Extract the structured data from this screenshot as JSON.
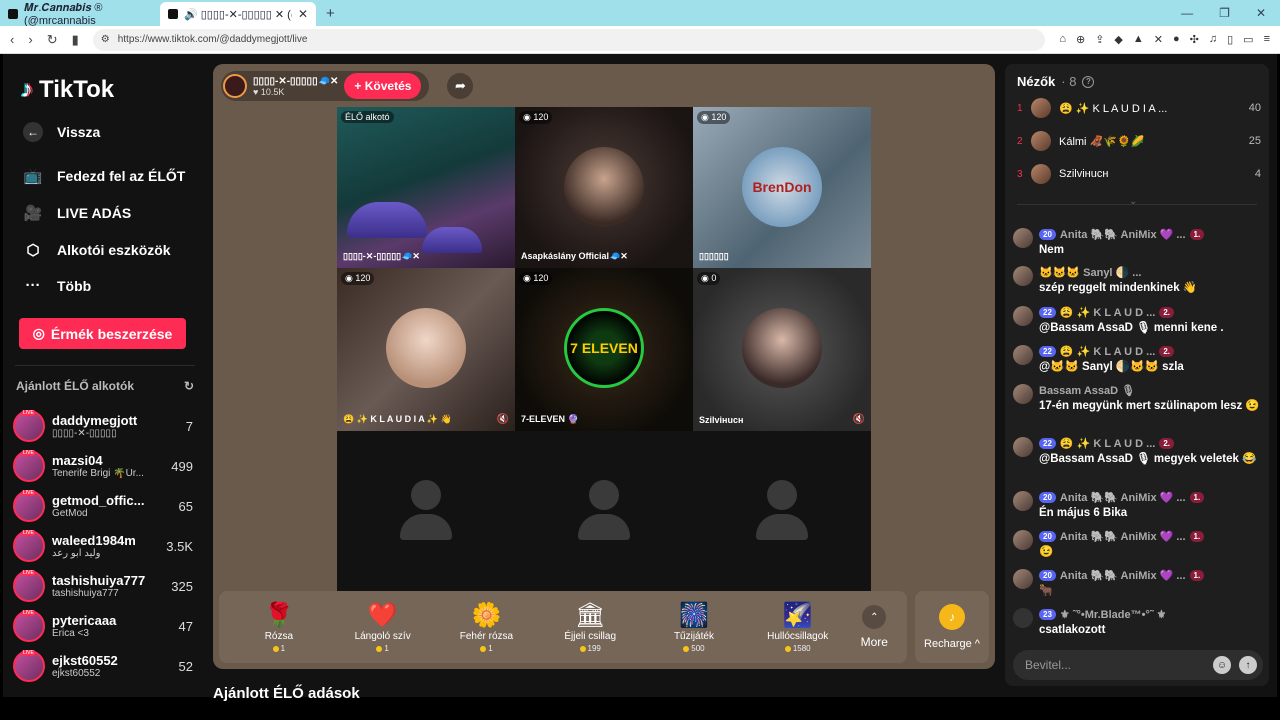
{
  "browser": {
    "tabs": [
      {
        "title": "𝑴𝒓.𝑪𝒂𝒏𝒏𝒂𝒃𝒊𝒔 ® (@mrcannabis"
      },
      {
        "title": "🔊 ▯▯▯▯-✕-▯▯▯▯▯ ✕ (@da"
      }
    ],
    "url": "https://www.tiktok.com/@daddymegjott/live"
  },
  "sidebar": {
    "logo": "TikTok",
    "back": "Vissza",
    "nav": [
      {
        "label": "Fedezd fel az ÉLŐT",
        "icon": "tv-icon",
        "glyph": "📺"
      },
      {
        "label": "LIVE ADÁS",
        "icon": "camera-icon",
        "glyph": "🎥"
      },
      {
        "label": "Alkotói eszközök",
        "icon": "creator-tools-icon",
        "glyph": "⬡"
      },
      {
        "label": "Több",
        "icon": "more-icon",
        "glyph": "···"
      }
    ],
    "coins_button": "Érmék beszerzése",
    "recommended_title": "Ajánlott ÉLŐ alkotók",
    "live_tag": "LIVE",
    "creators": [
      {
        "name": "daddymegjott",
        "sub": "▯▯▯▯-✕-▯▯▯▯▯",
        "count": "7"
      },
      {
        "name": "mazsi04",
        "sub": "Tenerife Brigi 🌴Úr...",
        "count": "499"
      },
      {
        "name": "getmod_offic...",
        "sub": "GetMod",
        "count": "65"
      },
      {
        "name": "waleed1984m",
        "sub": "وليد ابو رعد",
        "count": "3.5K"
      },
      {
        "name": "tashishuiya777",
        "sub": "tashishuiya777",
        "count": "325"
      },
      {
        "name": "pytericaaa",
        "sub": "Erica <3",
        "count": "47"
      },
      {
        "name": "ejkst60552",
        "sub": "ejkst60552",
        "count": "52"
      }
    ]
  },
  "stage": {
    "host_name": "▯▯▯▯-✕-▯▯▯▯▯🧢✕",
    "host_likes": "♥ 10.5K",
    "follow": "+ Követés",
    "cells": [
      {
        "badge": "ÉLŐ alkotó",
        "name": "▯▯▯▯-✕-▯▯▯▯▯🧢✕"
      },
      {
        "badge": "◉ 120",
        "name": "Asapkáslány Official🧢✕"
      },
      {
        "badge": "◉ 120",
        "name": "▯▯▯▯▯▯",
        "face_text": "BrenDon"
      },
      {
        "badge": "◉ 120",
        "name": "😩 ✨ K L A U D I A ✨ 👋"
      },
      {
        "badge": "◉ 120",
        "name": "7-ELEVEN 🔮",
        "face_text": "7 ELEVEN"
      },
      {
        "badge": "◉ 0",
        "name": "Szilviнucн"
      }
    ],
    "gifts": [
      {
        "name": "Rózsa",
        "price": "1",
        "icon": "rose-icon",
        "glyph": "🌹"
      },
      {
        "name": "Lángoló szív",
        "price": "1",
        "icon": "heart-icon",
        "glyph": "❤️"
      },
      {
        "name": "Fehér rózsa",
        "price": "1",
        "icon": "white-rose-icon",
        "glyph": "🌼"
      },
      {
        "name": "Éjjeli csillag",
        "price": "199",
        "icon": "night-star-icon",
        "glyph": "🏛"
      },
      {
        "name": "Tűzijáték",
        "price": "500",
        "icon": "firework-icon",
        "glyph": "🎆"
      },
      {
        "name": "Hullócsillagok",
        "price": "1580",
        "icon": "shooting-stars-icon",
        "glyph": "🌠"
      }
    ],
    "more": "More",
    "recharge": "Recharge ^",
    "recommended_live": "Ajánlott ÉLŐ adások"
  },
  "chat": {
    "viewers_title": "Nézők",
    "viewers_count": "· 8",
    "viewers": [
      {
        "rank": "1",
        "name": "😩 ✨ K L A U D I A ...",
        "score": "40"
      },
      {
        "rank": "2",
        "name": "Kálmi 🦧🌾🌻🌽",
        "score": "25"
      },
      {
        "rank": "3",
        "name": "Szilviнucн",
        "score": "4"
      }
    ],
    "messages": [
      {
        "level": "20",
        "user": "Anita 🐘🐘 AniMix 💜 ...",
        "fan": "1.",
        "text": "Nem"
      },
      {
        "level": "",
        "user": "🐱🐱🐱 Sanyl 🌗 ...",
        "fan": "",
        "text": "szép reggelt mindenkinek 👋"
      },
      {
        "level": "22",
        "user": "😩 ✨ K L A U D ...",
        "fan": "2.",
        "text": "@Bassam AssaD 🎙 menni kene ."
      },
      {
        "level": "22",
        "user": "😩 ✨ K L A U D ...",
        "fan": "2.",
        "text": "@🐱🐱 Sanyl 🌗🐱🐱 szla"
      },
      {
        "level": "",
        "user": "Bassam AssaD 🎙",
        "fan": "",
        "text": "17-én megyünk mert szülinapom lesz 😉"
      },
      {
        "level": "22",
        "user": "😩 ✨ K L A U D ...",
        "fan": "2.",
        "text": "@Bassam AssaD 🎙 megyek veletek 😂"
      },
      {
        "level": "20",
        "user": "Anita 🐘🐘 AniMix 💜 ...",
        "fan": "1.",
        "text": "Én május 6 Bika"
      },
      {
        "level": "20",
        "user": "Anita 🐘🐘 AniMix 💜 ...",
        "fan": "1.",
        "text": "😉"
      },
      {
        "level": "20",
        "user": "Anita 🐘🐘 AniMix 💜 ...",
        "fan": "1.",
        "text": "🐂"
      },
      {
        "level": "23",
        "user": "⚜ ˜°•Mr.Blade™•°˜ ⚜",
        "fan": "",
        "text": "csatlakozott"
      }
    ],
    "input_placeholder": "Bevitel..."
  }
}
